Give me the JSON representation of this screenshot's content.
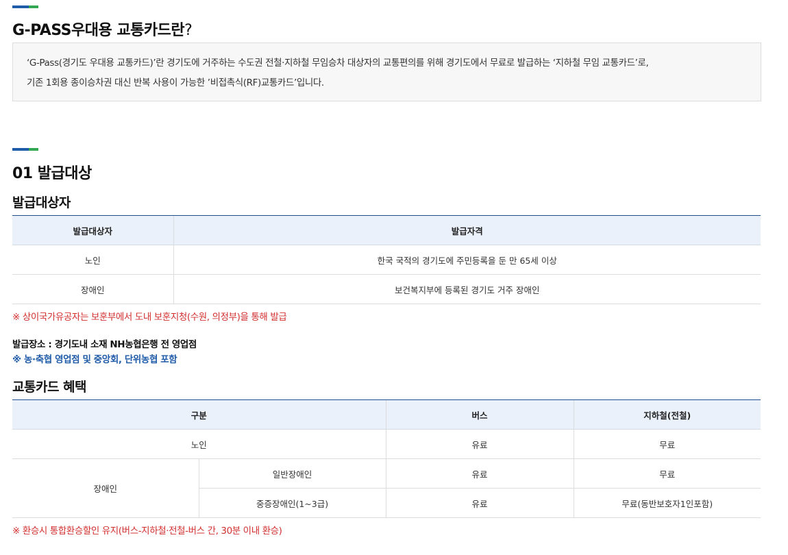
{
  "section_intro": {
    "title": "G-PASS우대용 교통카드란",
    "title_mark": "?",
    "body_line1": "‘G-Pass(경기도 우대용 교통카드)’란 경기도에 거주하는 수도권 전철·지하철 무임승차 대상자의 교통편의를 위해 경기도에서 무료로 발급하는 ‘지하철 무임 교통카드’로,",
    "body_line2": "기존 1회용 종이승차권 대신 반복 사용이 가능한 ’비접촉식(RF)교통카드’입니다."
  },
  "section_01": {
    "title": "01 발급대상",
    "eligibility": {
      "subtitle": "발급대상자",
      "headers": [
        "발급대상자",
        "발급자격"
      ],
      "rows": [
        {
          "target": "노인",
          "qualification": "한국 국적의 경기도에 주민등록을 둔 만 65세 이상"
        },
        {
          "target": "장애인",
          "qualification": "보건복지부에 등록된 경기도 거주 장애인"
        }
      ],
      "note": "※ 상이국가유공자는 보훈부에서 도내 보훈지청(수원, 의정부)을 통해 발급"
    },
    "issue_place": {
      "text": "발급장소 : 경기도내 소재 NH농협은행 전 영업점",
      "note": "※ 농·축협 영업점 및 중앙회, 단위농협 포함"
    },
    "benefits": {
      "subtitle": "교통카드 혜택",
      "headers": [
        "구분",
        "버스",
        "지하철(전철)"
      ],
      "row_elderly": {
        "category": "노인",
        "bus": "유료",
        "subway": "무료"
      },
      "disabled_label": "장애인",
      "row_general": {
        "sub": "일반장애인",
        "bus": "유료",
        "subway": "무료"
      },
      "row_severe": {
        "sub": "중증장애인(1~3급)",
        "bus": "유료",
        "subway": "무료(동반보호자1인포함)"
      },
      "note": "※ 환승시 통합환승할인 유지(버스-지하철·전철-버스 간, 30분 이내 환승)"
    }
  },
  "colors": {
    "accent_blue": "#1f5ba8",
    "accent_green": "#34a853",
    "note_red": "#d32f2f",
    "header_bg": "#eaf1fa"
  }
}
